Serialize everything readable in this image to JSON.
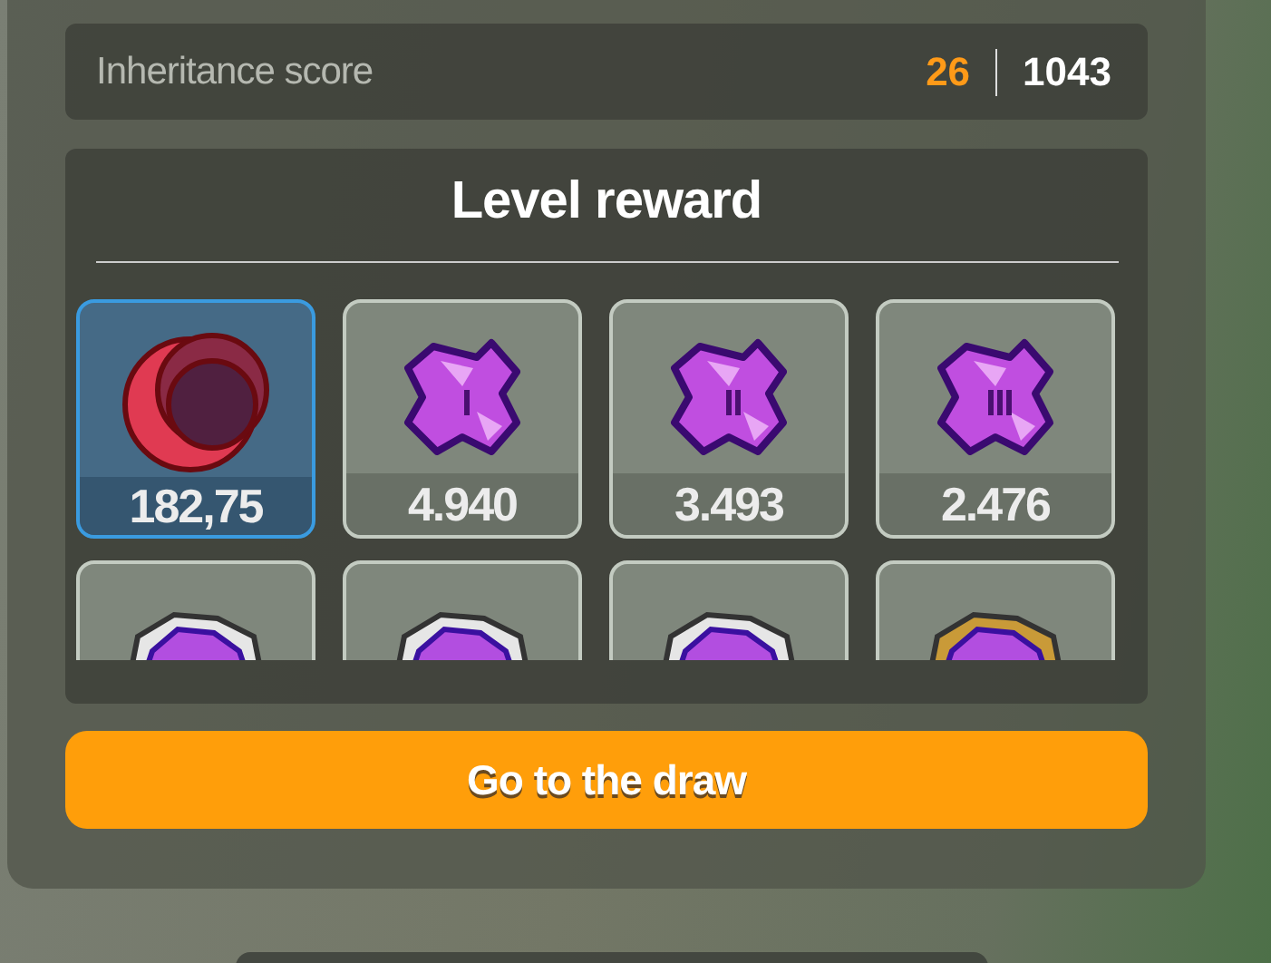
{
  "score": {
    "label": "Inheritance score",
    "current": "26",
    "total": "1043"
  },
  "reward": {
    "title": "Level reward",
    "items": [
      {
        "kind": "moon",
        "value": "182,75",
        "selected": true
      },
      {
        "kind": "crystal1",
        "value": "4.940",
        "selected": false
      },
      {
        "kind": "crystal2",
        "value": "3.493",
        "selected": false
      },
      {
        "kind": "crystal3",
        "value": "2.476",
        "selected": false
      },
      {
        "kind": "silverframed",
        "selected": false
      },
      {
        "kind": "silverframed",
        "selected": false
      },
      {
        "kind": "silverframed",
        "selected": false
      },
      {
        "kind": "goldframed",
        "selected": false
      }
    ]
  },
  "action": {
    "label": "Go to the draw"
  }
}
